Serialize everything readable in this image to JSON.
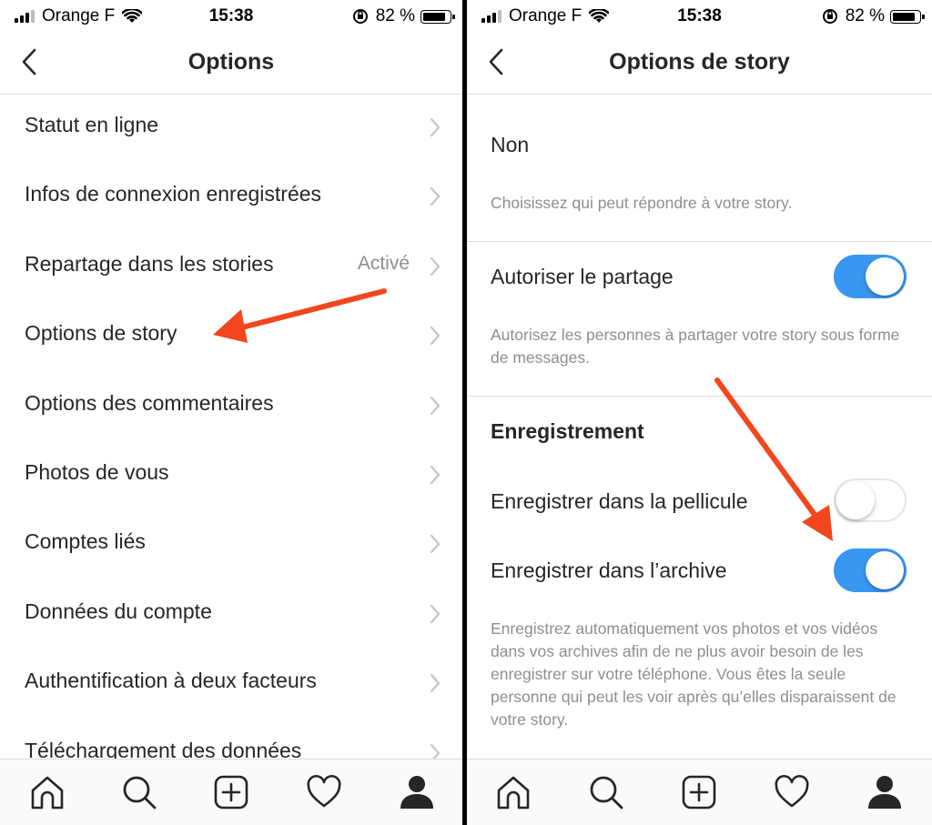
{
  "status": {
    "carrier": "Orange F",
    "time": "15:38",
    "battery": "82 %",
    "battery_level": 0.82
  },
  "left": {
    "title": "Options",
    "items": [
      {
        "label": "Statut en ligne",
        "value": ""
      },
      {
        "label": "Infos de connexion enregistrées",
        "value": ""
      },
      {
        "label": "Repartage dans les stories",
        "value": "Activé"
      },
      {
        "label": "Options de story",
        "value": ""
      },
      {
        "label": "Options des commentaires",
        "value": ""
      },
      {
        "label": "Photos de vous",
        "value": ""
      },
      {
        "label": "Comptes liés",
        "value": ""
      },
      {
        "label": "Données du compte",
        "value": ""
      },
      {
        "label": "Authentification à deux facteurs",
        "value": ""
      },
      {
        "label": "Téléchargement des données",
        "value": ""
      }
    ]
  },
  "right": {
    "title": "Options de story",
    "reply_value": "Non",
    "reply_desc": "Choisissez qui peut répondre à votre story.",
    "share_label": "Autoriser le partage",
    "share_on": true,
    "share_desc": "Autorisez les personnes à partager votre story sous forme de messages.",
    "saving_heading": "Enregistrement",
    "save_camera_label": "Enregistrer dans la pellicule",
    "save_camera_on": false,
    "save_archive_label": "Enregistrer dans l’archive",
    "save_archive_on": true,
    "save_desc": "Enregistrez automatiquement vos photos et vos vidéos dans vos archives afin de ne plus avoir besoin de les enregistrer sur votre téléphone. Vous êtes la seule personne qui peut les voir après qu’elles disparaissent de votre story."
  },
  "tabbar": [
    "home-icon",
    "search-icon",
    "add-icon",
    "heart-icon",
    "profile-icon"
  ],
  "colors": {
    "accent": "#3897f0",
    "arrow": "#f2461e",
    "secondary_text": "#8e8e8e"
  }
}
